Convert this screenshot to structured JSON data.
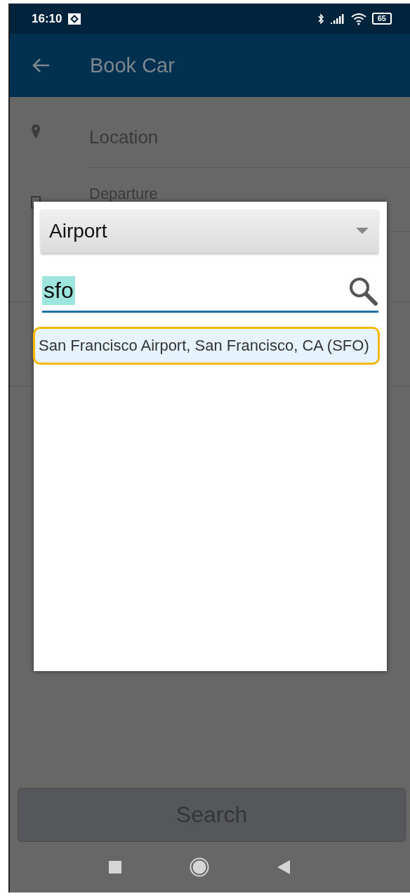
{
  "status_bar": {
    "time": "16:10",
    "battery": "65"
  },
  "app_bar": {
    "title": "Book Car"
  },
  "form_fields": [
    {
      "label": "Location",
      "kind": "location"
    },
    {
      "label": "Departure",
      "kind": "date"
    }
  ],
  "dialog": {
    "dropdown": {
      "value": "Airport"
    },
    "search": {
      "value": "sfo",
      "highlighted": true
    },
    "results": [
      {
        "text": "San Francisco Airport, San Francisco, CA (SFO)",
        "selected": true
      }
    ]
  },
  "search_button": {
    "label": "Search"
  }
}
